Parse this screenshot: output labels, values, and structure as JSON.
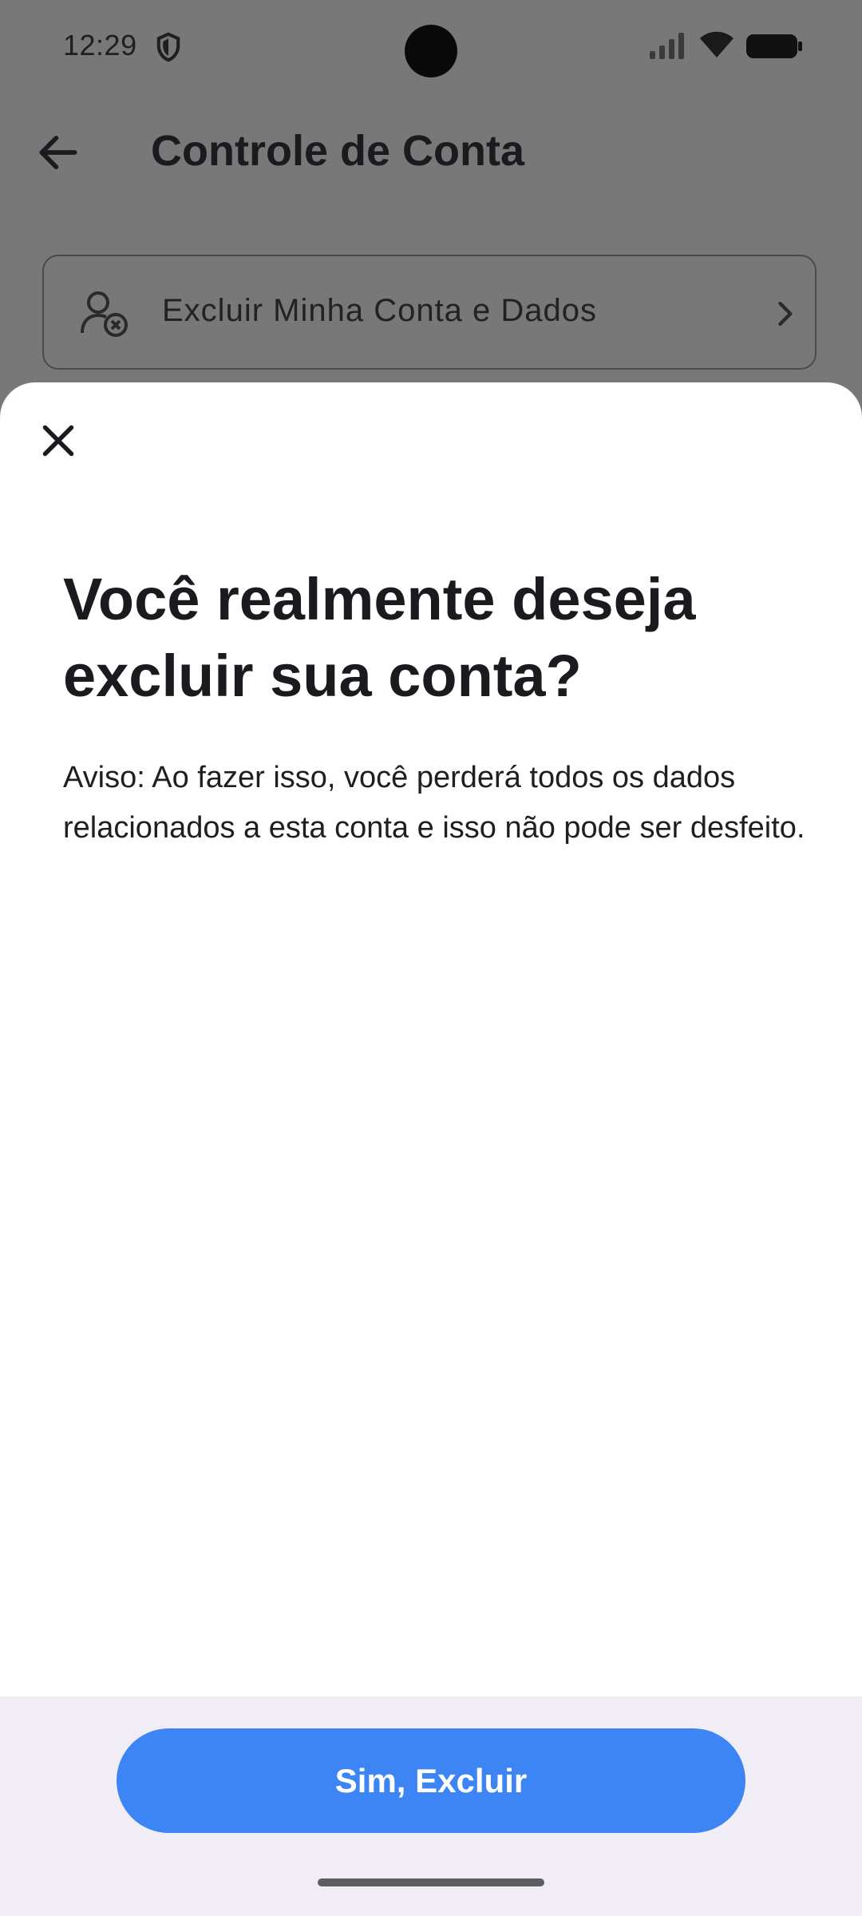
{
  "status_bar": {
    "time": "12:29",
    "icons": [
      "shield-icon",
      "cellular-signal-icon",
      "wifi-icon",
      "battery-icon"
    ]
  },
  "app_bar": {
    "back_icon": "arrow-left-icon",
    "title": "Controle de Conta"
  },
  "account_card": {
    "icon": "user-remove-icon",
    "label": "Excluir Minha Conta e Dados",
    "trailing_icon": "chevron-right-icon"
  },
  "dialog": {
    "close_icon": "close-icon",
    "title": "Você realmente deseja excluir sua conta?",
    "warning": "Aviso: Ao fazer isso, você perderá todos os dados relacionados a esta conta e isso não pode ser desfeito.",
    "confirm_label": "Sim, Excluir"
  },
  "colors": {
    "accent": "#3d84f5",
    "scrim": "#787878",
    "footer_bg": "#f1edf7"
  }
}
